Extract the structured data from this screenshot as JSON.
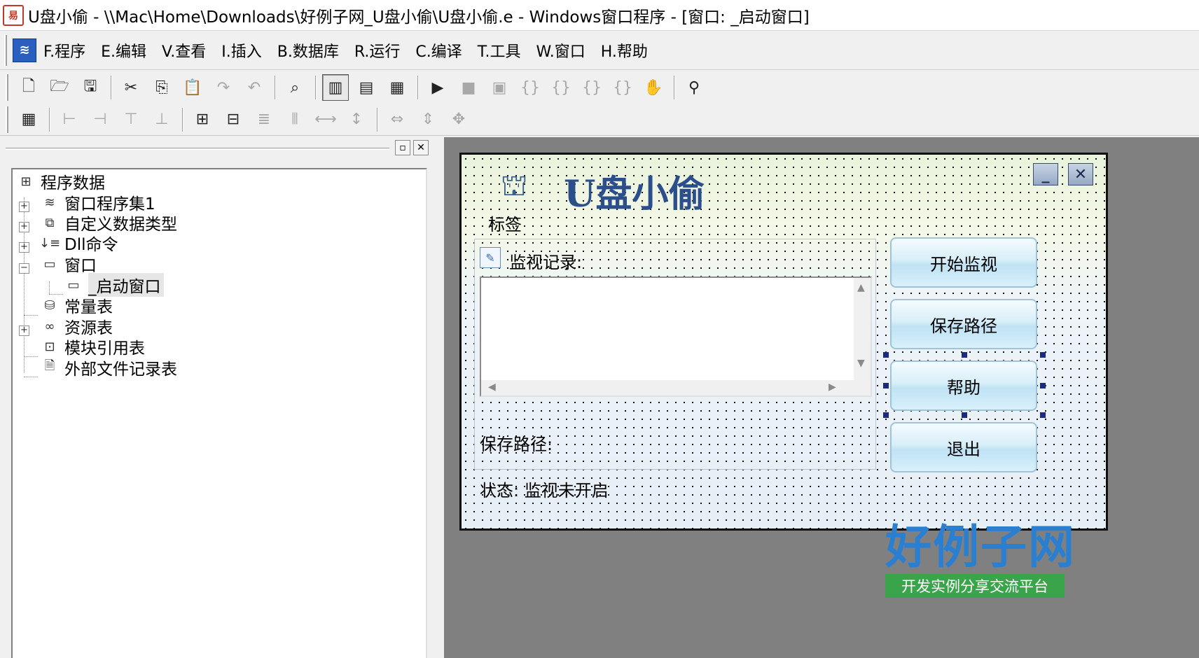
{
  "window": {
    "title": "U盘小偷 - \\\\Mac\\Home\\Downloads\\好例子网_U盘小偷\\U盘小偷.e - Windows窗口程序 - [窗口: _启动窗口]"
  },
  "menu": {
    "items": [
      "F.程序",
      "E.编辑",
      "V.查看",
      "I.插入",
      "B.数据库",
      "R.运行",
      "C.编译",
      "T.工具",
      "W.窗口",
      "H.帮助"
    ]
  },
  "tree": {
    "root": "程序数据",
    "items": [
      {
        "label": "窗口程序集1",
        "icon": "stack-icon"
      },
      {
        "label": "自定义数据类型",
        "icon": "type-icon"
      },
      {
        "label": "Dll命令",
        "icon": "dll-icon"
      },
      {
        "label": "窗口",
        "icon": "window-icon"
      },
      {
        "label": "_启动窗口",
        "icon": "window-icon"
      },
      {
        "label": "常量表",
        "icon": "constants-icon"
      },
      {
        "label": "资源表",
        "icon": "resources-icon"
      },
      {
        "label": "模块引用表",
        "icon": "module-icon"
      },
      {
        "label": "外部文件记录表",
        "icon": "file-icon"
      }
    ]
  },
  "form": {
    "title": "U盘小偷",
    "tag_label": "标签",
    "group_label": "监视记录:",
    "path_label": "保存路径:",
    "status_label": "状态: 监视未开启",
    "buttons": {
      "start": "开始监视",
      "save_path": "保存路径",
      "help": "帮助",
      "exit": "退出"
    }
  },
  "watermark": {
    "title": "好例子网",
    "subtitle": "开发实例分享交流平台"
  }
}
